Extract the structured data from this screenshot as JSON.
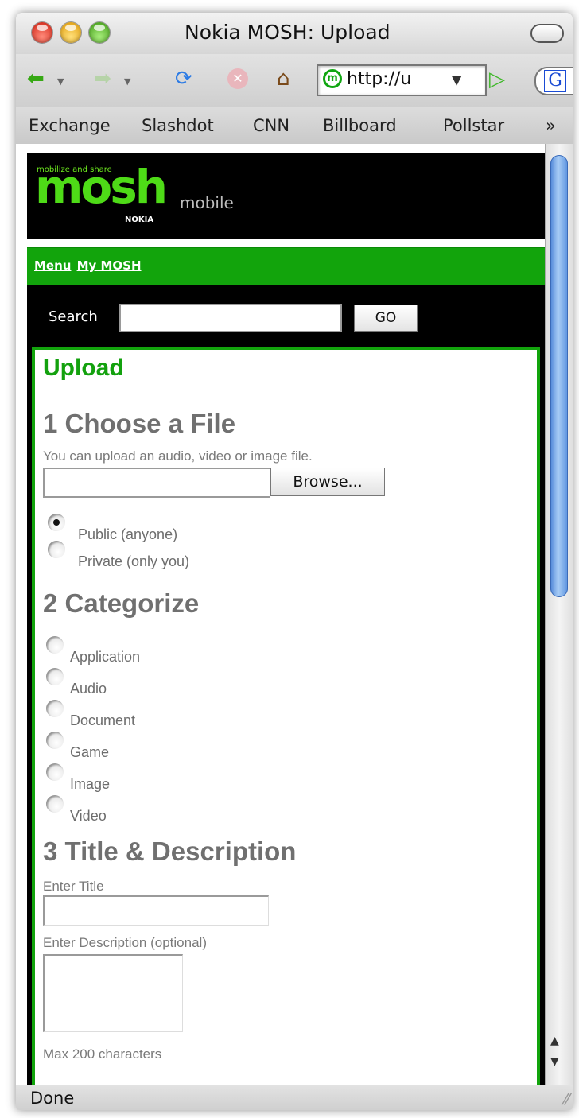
{
  "window": {
    "title": "Nokia MOSH: Upload"
  },
  "toolbar": {
    "back_icon": "back-arrow-icon",
    "forward_icon": "forward-arrow-icon",
    "reload_icon": "reload-icon",
    "stop_icon": "stop-icon",
    "home_icon": "home-icon",
    "url": "http://u",
    "go_icon": "go-arrow-icon",
    "search_engine_letter": "G"
  },
  "bookmarks": [
    "Exchange",
    "Slashdot",
    "CNN",
    "Billboard",
    "Pollstar"
  ],
  "bookmarks_more": "»",
  "page": {
    "logo": {
      "tagline": "mobilize and share",
      "wordmark": "mosh",
      "suffix": "mobile",
      "brand": "NOKIA"
    },
    "nav": {
      "menu": "Menu",
      "my_mosh": "My MOSH"
    },
    "search": {
      "label": "Search",
      "button": "GO",
      "value": ""
    },
    "upload_title": "Upload",
    "step1": {
      "heading": "1 Choose a File",
      "hint": "You can upload an audio, video or image file.",
      "browse": "Browse...",
      "visibility": [
        {
          "label": "Public (anyone)",
          "checked": true
        },
        {
          "label": "Private (only you)",
          "checked": false
        }
      ]
    },
    "step2": {
      "heading": "2 Categorize",
      "categories": [
        "Application",
        "Audio",
        "Document",
        "Game",
        "Image",
        "Video"
      ]
    },
    "step3": {
      "heading": "3 Title & Description",
      "title_label": "Enter Title",
      "desc_label": "Enter Description (optional)",
      "max_note": "Max 200 characters"
    }
  },
  "status": {
    "text": "Done"
  },
  "colors": {
    "brand_green": "#12a40c",
    "heading_gray": "#707070",
    "logo_green": "#4edb17"
  }
}
